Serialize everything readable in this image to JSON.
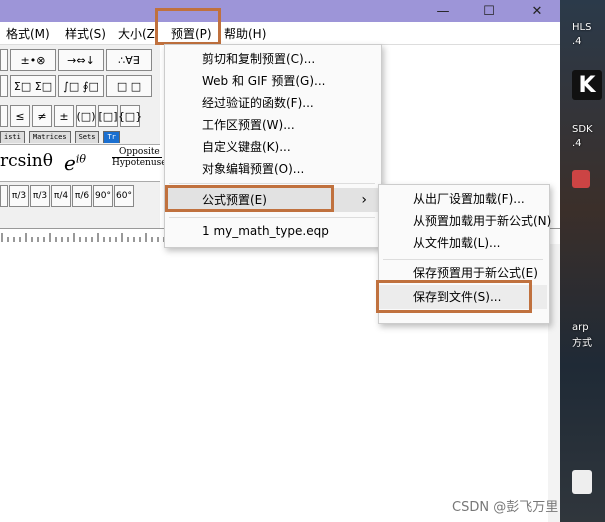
{
  "menubar": {
    "items": [
      {
        "label": "格式(M)"
      },
      {
        "label": "样式(S)"
      },
      {
        "label": "大小(Z"
      },
      {
        "label": "预置(P)"
      },
      {
        "label": "帮助(H)"
      }
    ]
  },
  "window_controls": {
    "minimize": "—",
    "maximize": "☐",
    "close": "✕"
  },
  "toolbar": {
    "row1": [
      "±•⊗",
      "→⇔↓",
      "∴∀∃"
    ],
    "row2": [
      "Σ□ Σ□",
      "∫□ ∮□",
      "□ □"
    ],
    "row3": [
      "≤",
      "≠",
      "±",
      "(□)",
      "[□]",
      "{□}"
    ],
    "tabs": [
      "isti",
      "Matrices",
      "Sets",
      "Tr"
    ],
    "templates": {
      "arcsin": "rcsinθ",
      "euler": "e",
      "euler_sup": "iθ",
      "fraction_top": "Opposite",
      "fraction_bottom": "Hypotenuse"
    },
    "row5": [
      "π/3",
      "π/3",
      "π/4",
      "π/6",
      "90°",
      "60°"
    ]
  },
  "preset_menu": {
    "items": [
      {
        "label": "剪切和复制预置(C)..."
      },
      {
        "label": "Web 和 GIF 预置(G)..."
      },
      {
        "label": "经过验证的函数(F)..."
      },
      {
        "label": "工作区预置(W)..."
      },
      {
        "label": "自定义键盘(K)..."
      },
      {
        "label": "对象编辑预置(O)..."
      },
      {
        "label": "公式预置(E)",
        "arrow": "›"
      },
      {
        "label": "1 my_math_type.eqp"
      }
    ]
  },
  "formula_submenu": {
    "items": [
      {
        "label": "从出厂设置加载(F)..."
      },
      {
        "label": "从预置加载用于新公式(N)"
      },
      {
        "label": "从文件加载(L)..."
      },
      {
        "label": "保存预置用于新公式(E)"
      },
      {
        "label": "保存到文件(S)..."
      }
    ]
  },
  "desktop": {
    "labels": [
      "HLS",
      ".4",
      "K",
      "SDK",
      ".4",
      "arp",
      "方式"
    ]
  },
  "watermark": "CSDN @彭飞万里",
  "colors": {
    "titlebar": "#9d95d8",
    "highlight_box": "#c0713e",
    "menu_bg": "#fafafa"
  }
}
